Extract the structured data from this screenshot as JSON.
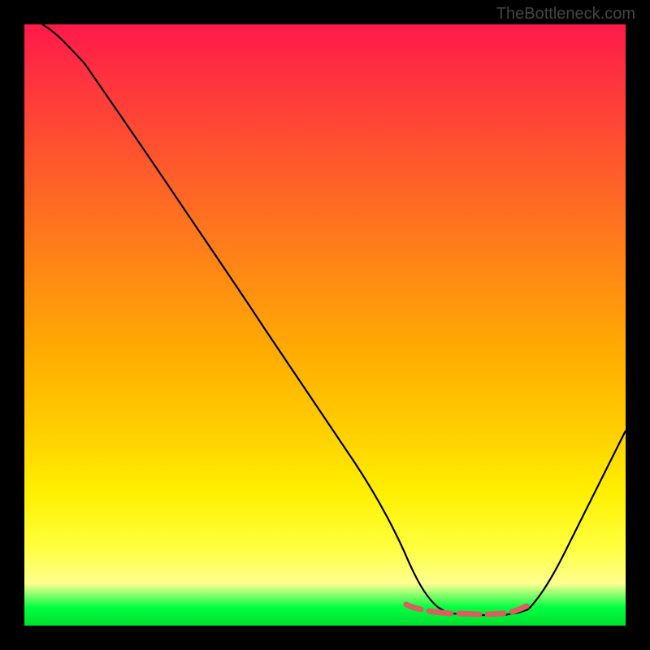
{
  "watermark": "TheBottleneck.com",
  "chart_data": {
    "type": "line",
    "title": "",
    "xlabel": "",
    "ylabel": "",
    "xlim": [
      0,
      100
    ],
    "ylim": [
      0,
      100
    ],
    "grid": false,
    "legend": false,
    "series": [
      {
        "name": "bottleneck-curve",
        "x": [
          3,
          6,
          10,
          15,
          20,
          25,
          30,
          35,
          40,
          45,
          50,
          55,
          60,
          63,
          66,
          70,
          74,
          78,
          82,
          85,
          88,
          91,
          94,
          97,
          100
        ],
        "y": [
          100,
          98.5,
          95,
          89,
          82,
          75,
          68,
          60,
          52,
          44,
          36,
          28,
          19,
          12,
          7,
          3.5,
          2,
          2,
          2.5,
          4,
          7,
          11,
          16,
          22,
          28
        ]
      },
      {
        "name": "optimal-band-highlight",
        "x": [
          63,
          66,
          70,
          74,
          78,
          82
        ],
        "y": [
          4.5,
          4,
          3.8,
          3.8,
          4,
          4.5
        ]
      }
    ],
    "background_gradient": {
      "stops": [
        {
          "pos": 0.0,
          "color": "#ff1a4a"
        },
        {
          "pos": 0.2,
          "color": "#ff5030"
        },
        {
          "pos": 0.44,
          "color": "#ff9010"
        },
        {
          "pos": 0.68,
          "color": "#ffd000"
        },
        {
          "pos": 0.87,
          "color": "#ffff40"
        },
        {
          "pos": 0.97,
          "color": "#00ff40"
        },
        {
          "pos": 1.0,
          "color": "#00e030"
        }
      ]
    }
  }
}
